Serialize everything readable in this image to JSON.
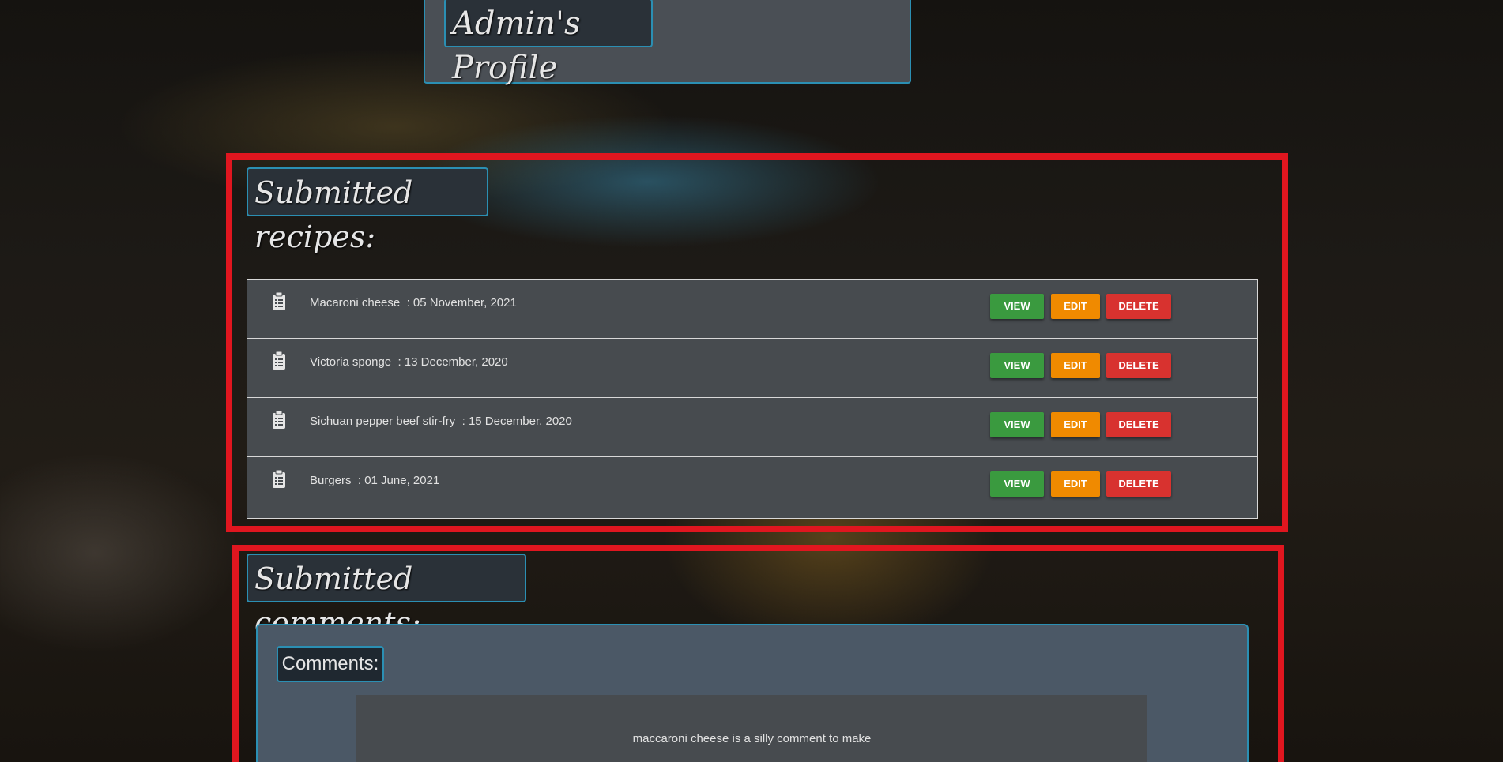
{
  "profile": {
    "title": "Admin's Profile"
  },
  "recipes": {
    "section_title": "Submitted recipes:",
    "items": [
      {
        "name": "Macaroni cheese",
        "date": "05 November, 2021"
      },
      {
        "name": "Victoria sponge",
        "date": "13 December, 2020"
      },
      {
        "name": "Sichuan pepper beef stir-fry",
        "date": "15 December, 2020"
      },
      {
        "name": "Burgers",
        "date": "01 June, 2021"
      }
    ],
    "view_label": "VIEW",
    "edit_label": "EDIT",
    "delete_label": "DELETE",
    "icon": "clipboard-list-icon"
  },
  "comments": {
    "section_title": "Submitted comments:",
    "panel_label": "Comments:",
    "items": [
      {
        "text": "maccaroni cheese is a silly comment to make"
      }
    ]
  },
  "colors": {
    "accent_border": "#2b8fb3",
    "highlight_red": "#e0161f",
    "view_green": "#3a9a3f",
    "edit_orange": "#f08a00",
    "delete_red": "#d8322f"
  }
}
